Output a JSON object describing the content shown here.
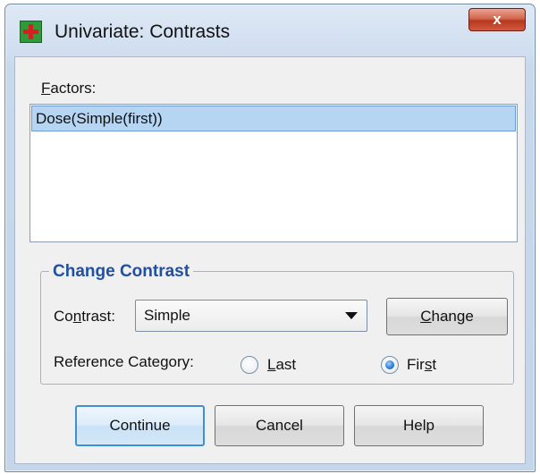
{
  "window": {
    "title": "Univariate: Contrasts",
    "close_label": "x",
    "app_icon": "spss-dialog-icon"
  },
  "factors": {
    "label_access_key": "F",
    "label_rest": "actors:",
    "items": [
      "Dose(Simple(first))"
    ],
    "selected_index": 0
  },
  "change_contrast": {
    "group_title": "Change Contrast",
    "contrast_label_pre": "Co",
    "contrast_label_key": "n",
    "contrast_label_post": "trast:",
    "contrast_value": "Simple",
    "change_button_key": "C",
    "change_button_rest": "hange",
    "reference_label": "Reference Category:",
    "radio_last_key": "L",
    "radio_last_rest": "ast",
    "radio_first_pre": "Fir",
    "radio_first_key": "s",
    "radio_first_post": "t",
    "selected_reference": "First"
  },
  "buttons": {
    "continue": "Continue",
    "cancel": "Cancel",
    "help": "Help"
  },
  "colors": {
    "group_title": "#1f4fa6",
    "selection": "#b6d5f2",
    "close_button": "#c94b30"
  }
}
